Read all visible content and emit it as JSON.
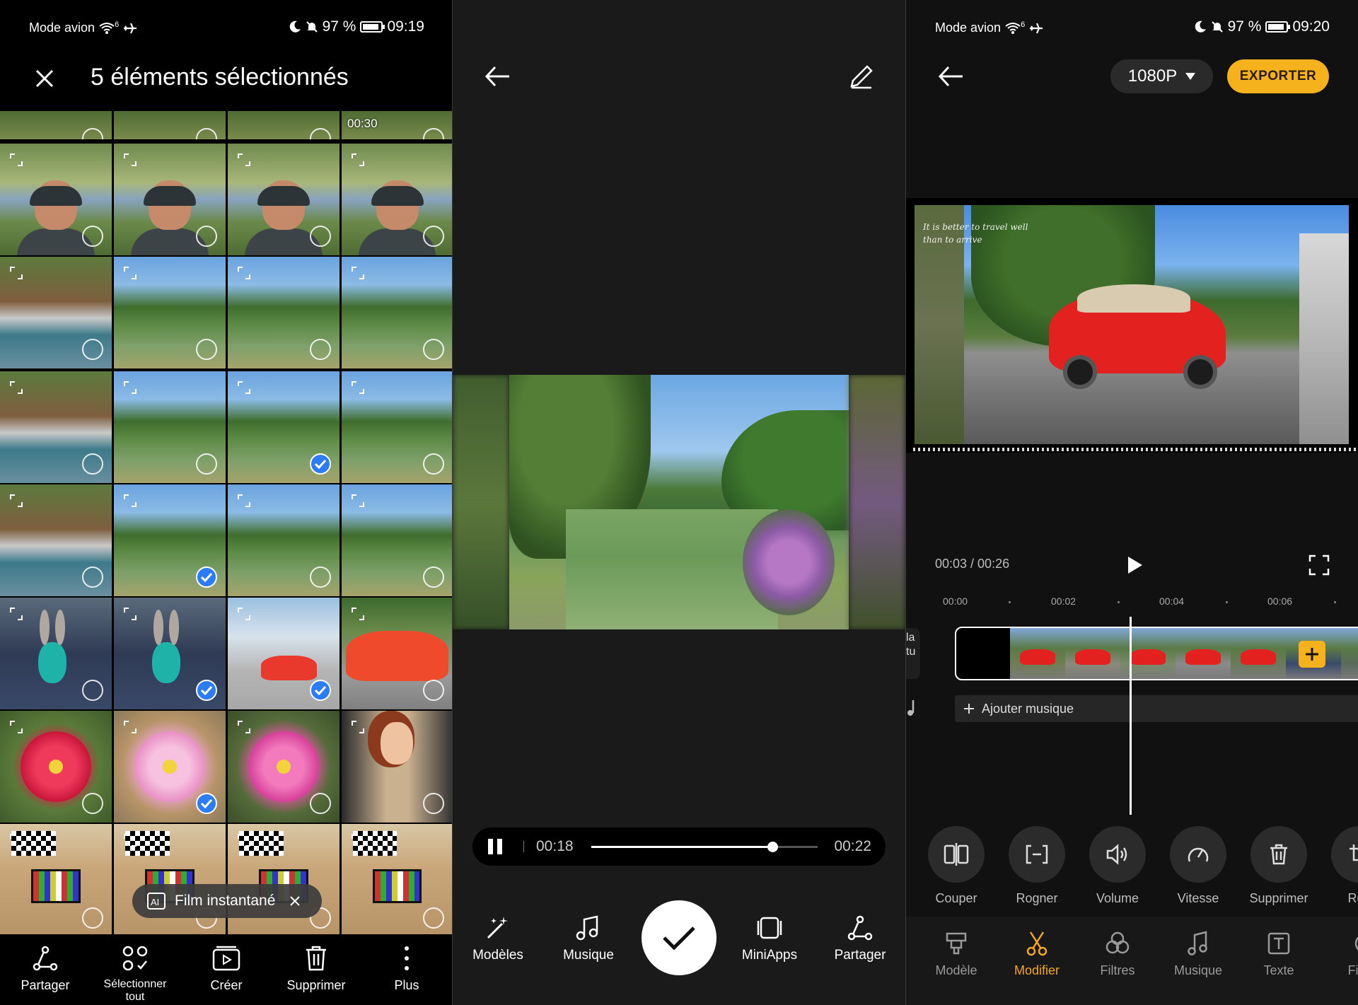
{
  "left": {
    "status": {
      "mode": "Mode avion",
      "battery": "97 %",
      "time": "09:19",
      "net": "6"
    },
    "title": "5 éléments sélectionnés",
    "tiles": [
      {
        "kind": "top",
        "checked": false
      },
      {
        "kind": "top",
        "checked": false
      },
      {
        "kind": "top",
        "checked": false
      },
      {
        "kind": "top",
        "checked": false,
        "duration": "00:30"
      },
      {
        "kind": "selfie",
        "checked": false
      },
      {
        "kind": "selfie",
        "checked": false
      },
      {
        "kind": "selfie",
        "checked": false
      },
      {
        "kind": "selfie",
        "checked": false
      },
      {
        "kind": "boats",
        "checked": false
      },
      {
        "kind": "canal",
        "checked": false
      },
      {
        "kind": "canal",
        "checked": false
      },
      {
        "kind": "canal",
        "checked": false
      },
      {
        "kind": "boats",
        "checked": false
      },
      {
        "kind": "canal",
        "checked": false
      },
      {
        "kind": "canal",
        "checked": true
      },
      {
        "kind": "canal",
        "checked": false
      },
      {
        "kind": "boats",
        "checked": false
      },
      {
        "kind": "canal",
        "checked": true
      },
      {
        "kind": "canal",
        "checked": false
      },
      {
        "kind": "canal",
        "checked": false
      },
      {
        "kind": "bunny",
        "checked": false
      },
      {
        "kind": "bunny",
        "checked": true
      },
      {
        "kind": "car",
        "checked": true
      },
      {
        "kind": "car-close",
        "checked": false
      },
      {
        "kind": "red-flower",
        "checked": false
      },
      {
        "kind": "pink-flower",
        "checked": true
      },
      {
        "kind": "pink-flower2",
        "checked": false
      },
      {
        "kind": "doll",
        "checked": false
      },
      {
        "kind": "palette",
        "checked": false
      },
      {
        "kind": "palette",
        "checked": false
      },
      {
        "kind": "palette",
        "checked": false
      },
      {
        "kind": "palette",
        "checked": false
      }
    ],
    "film_chip": "Film instantané",
    "toolbar": [
      {
        "label": "Partager",
        "icon": "share-icon"
      },
      {
        "label": "Sélectionner",
        "label2": "tout",
        "icon": "select-all-icon"
      },
      {
        "label": "Créer",
        "icon": "create-icon"
      },
      {
        "label": "Supprimer",
        "icon": "trash-icon"
      },
      {
        "label": "Plus",
        "icon": "more-icon"
      }
    ]
  },
  "middle": {
    "player": {
      "current": "00:18",
      "total": "00:22",
      "progress": 0.8
    },
    "toolbar": [
      {
        "label": "Modèles",
        "icon": "magic-wand-icon"
      },
      {
        "label": "Musique",
        "icon": "music-note-icon"
      },
      {
        "label": "MiniApps",
        "icon": "miniapps-icon"
      },
      {
        "label": "Partager",
        "icon": "share-icon"
      }
    ]
  },
  "right": {
    "status": {
      "mode": "Mode avion",
      "battery": "97 %",
      "time": "09:20",
      "net": "6"
    },
    "resolution": "1080P",
    "export": "EXPORTER",
    "quote": "It is better to travel well than to arrive",
    "time": "00:03 / 00:26",
    "ruler": [
      "00:00",
      "00:02",
      "00:04",
      "00:06"
    ],
    "clip_side": "la tu",
    "add_music": "Ajouter musique",
    "tools": [
      {
        "label": "Couper",
        "icon": "split-icon"
      },
      {
        "label": "Rogner",
        "icon": "trim-icon"
      },
      {
        "label": "Volume",
        "icon": "volume-icon"
      },
      {
        "label": "Vitesse",
        "icon": "speed-icon"
      },
      {
        "label": "Supprimer",
        "icon": "trash-icon"
      },
      {
        "label": "Rog",
        "icon": "crop-icon"
      }
    ],
    "tabs": [
      {
        "label": "Modèle",
        "icon": "template-icon",
        "active": false
      },
      {
        "label": "Modifier",
        "icon": "scissors-icon",
        "active": true
      },
      {
        "label": "Filtres",
        "icon": "filters-icon",
        "active": false
      },
      {
        "label": "Musique",
        "icon": "music-note-icon",
        "active": false
      },
      {
        "label": "Texte",
        "icon": "text-icon",
        "active": false
      },
      {
        "label": "Filig",
        "icon": "watermark-icon",
        "active": false
      }
    ],
    "colors": {
      "accent": "#f5b21d",
      "active_tab": "#f5a623",
      "check": "#2c7cf6"
    }
  }
}
